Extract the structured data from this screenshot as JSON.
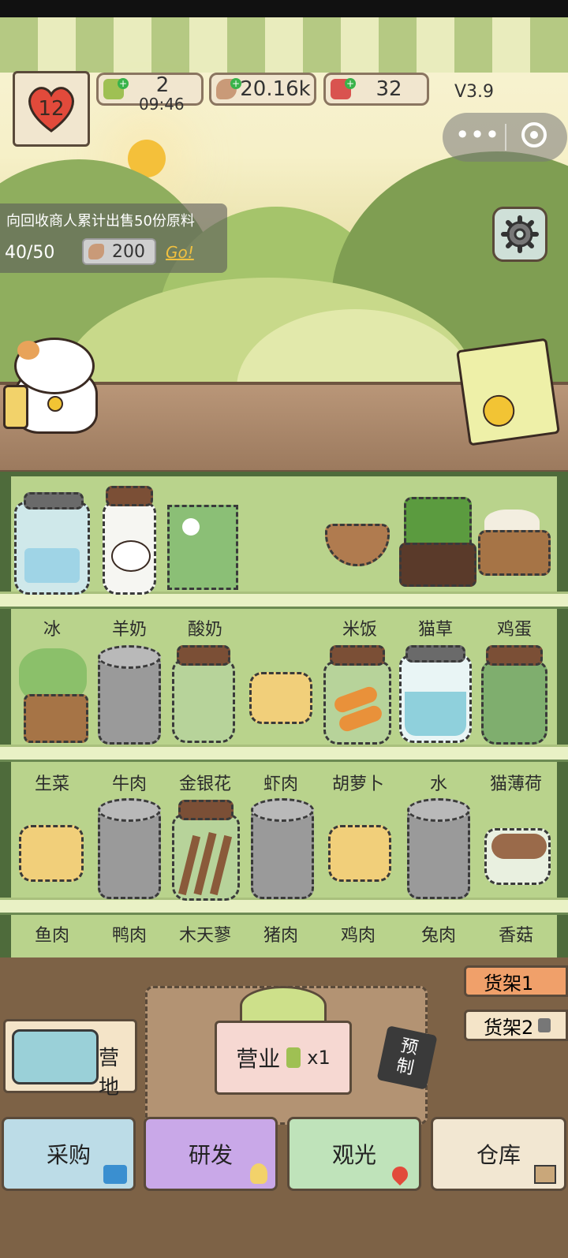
{
  "hud": {
    "hearts": "12",
    "tickets": "2",
    "timer": "09:46",
    "fish": "20.16k",
    "cards": "32",
    "version": "V3.9"
  },
  "quest": {
    "text": "向回收商人累计出售50份原料",
    "progress": "40/50",
    "reward": "200",
    "go": "Go!"
  },
  "shelves": {
    "row1": [
      "冰",
      "羊奶",
      "酸奶",
      "",
      "米饭",
      "猫草",
      "鸡蛋"
    ],
    "row2": [
      "生菜",
      "牛肉",
      "金银花",
      "虾肉",
      "胡萝卜",
      "水",
      "猫薄荷"
    ],
    "row3": [
      "鱼肉",
      "鸭肉",
      "木天蓼",
      "猪肉",
      "鸡肉",
      "兔肉",
      "香菇"
    ]
  },
  "tabs": {
    "shelf1": "货架1",
    "shelf2": "货架2"
  },
  "camp": "营地",
  "business": {
    "label": "营业",
    "multiplier": "x1"
  },
  "prebuild": "预制",
  "nav": {
    "buy": "采购",
    "research": "研发",
    "tour": "观光",
    "warehouse": "仓库"
  },
  "colors": {
    "buy": "#bcdce7",
    "research": "#c9a8e8",
    "tour": "#bfe3ba",
    "warehouse": "#f2e7d2"
  }
}
